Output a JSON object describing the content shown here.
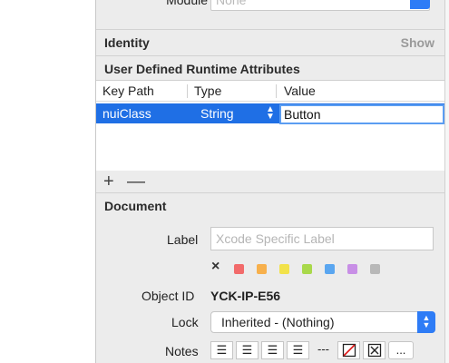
{
  "module": {
    "label": "Module",
    "placeholder": "None"
  },
  "identity": {
    "title": "Identity",
    "show_label": "Show"
  },
  "runtime_attributes": {
    "title": "User Defined Runtime Attributes",
    "columns": [
      "Key Path",
      "Type",
      "Value"
    ],
    "rows": [
      {
        "key_path": "nuiClass",
        "type": "String",
        "value": "Button"
      }
    ],
    "add_label": "+",
    "remove_label": "—"
  },
  "document": {
    "title": "Document",
    "label_label": "Label",
    "label_placeholder": "Xcode Specific Label",
    "clear_color_label": "×",
    "label_colors": [
      "#f26b6b",
      "#f7b04c",
      "#f2e24a",
      "#a9d94b",
      "#5aa6f0",
      "#c88fe6",
      "#b8b8b8"
    ],
    "object_id_label": "Object ID",
    "object_id_value": "YCK-IP-E56",
    "lock_label": "Lock",
    "lock_value": "Inherited - (Nothing)",
    "notes_label": "Notes",
    "notes_buttons": [
      "align-left-icon",
      "align-center-icon",
      "align-right-icon",
      "align-justify-icon",
      "---",
      "no-border-icon",
      "checkbox-cross-icon",
      "..."
    ]
  },
  "colors": {
    "selection": "#1f6fe5",
    "accent": "#2e7cf6"
  }
}
